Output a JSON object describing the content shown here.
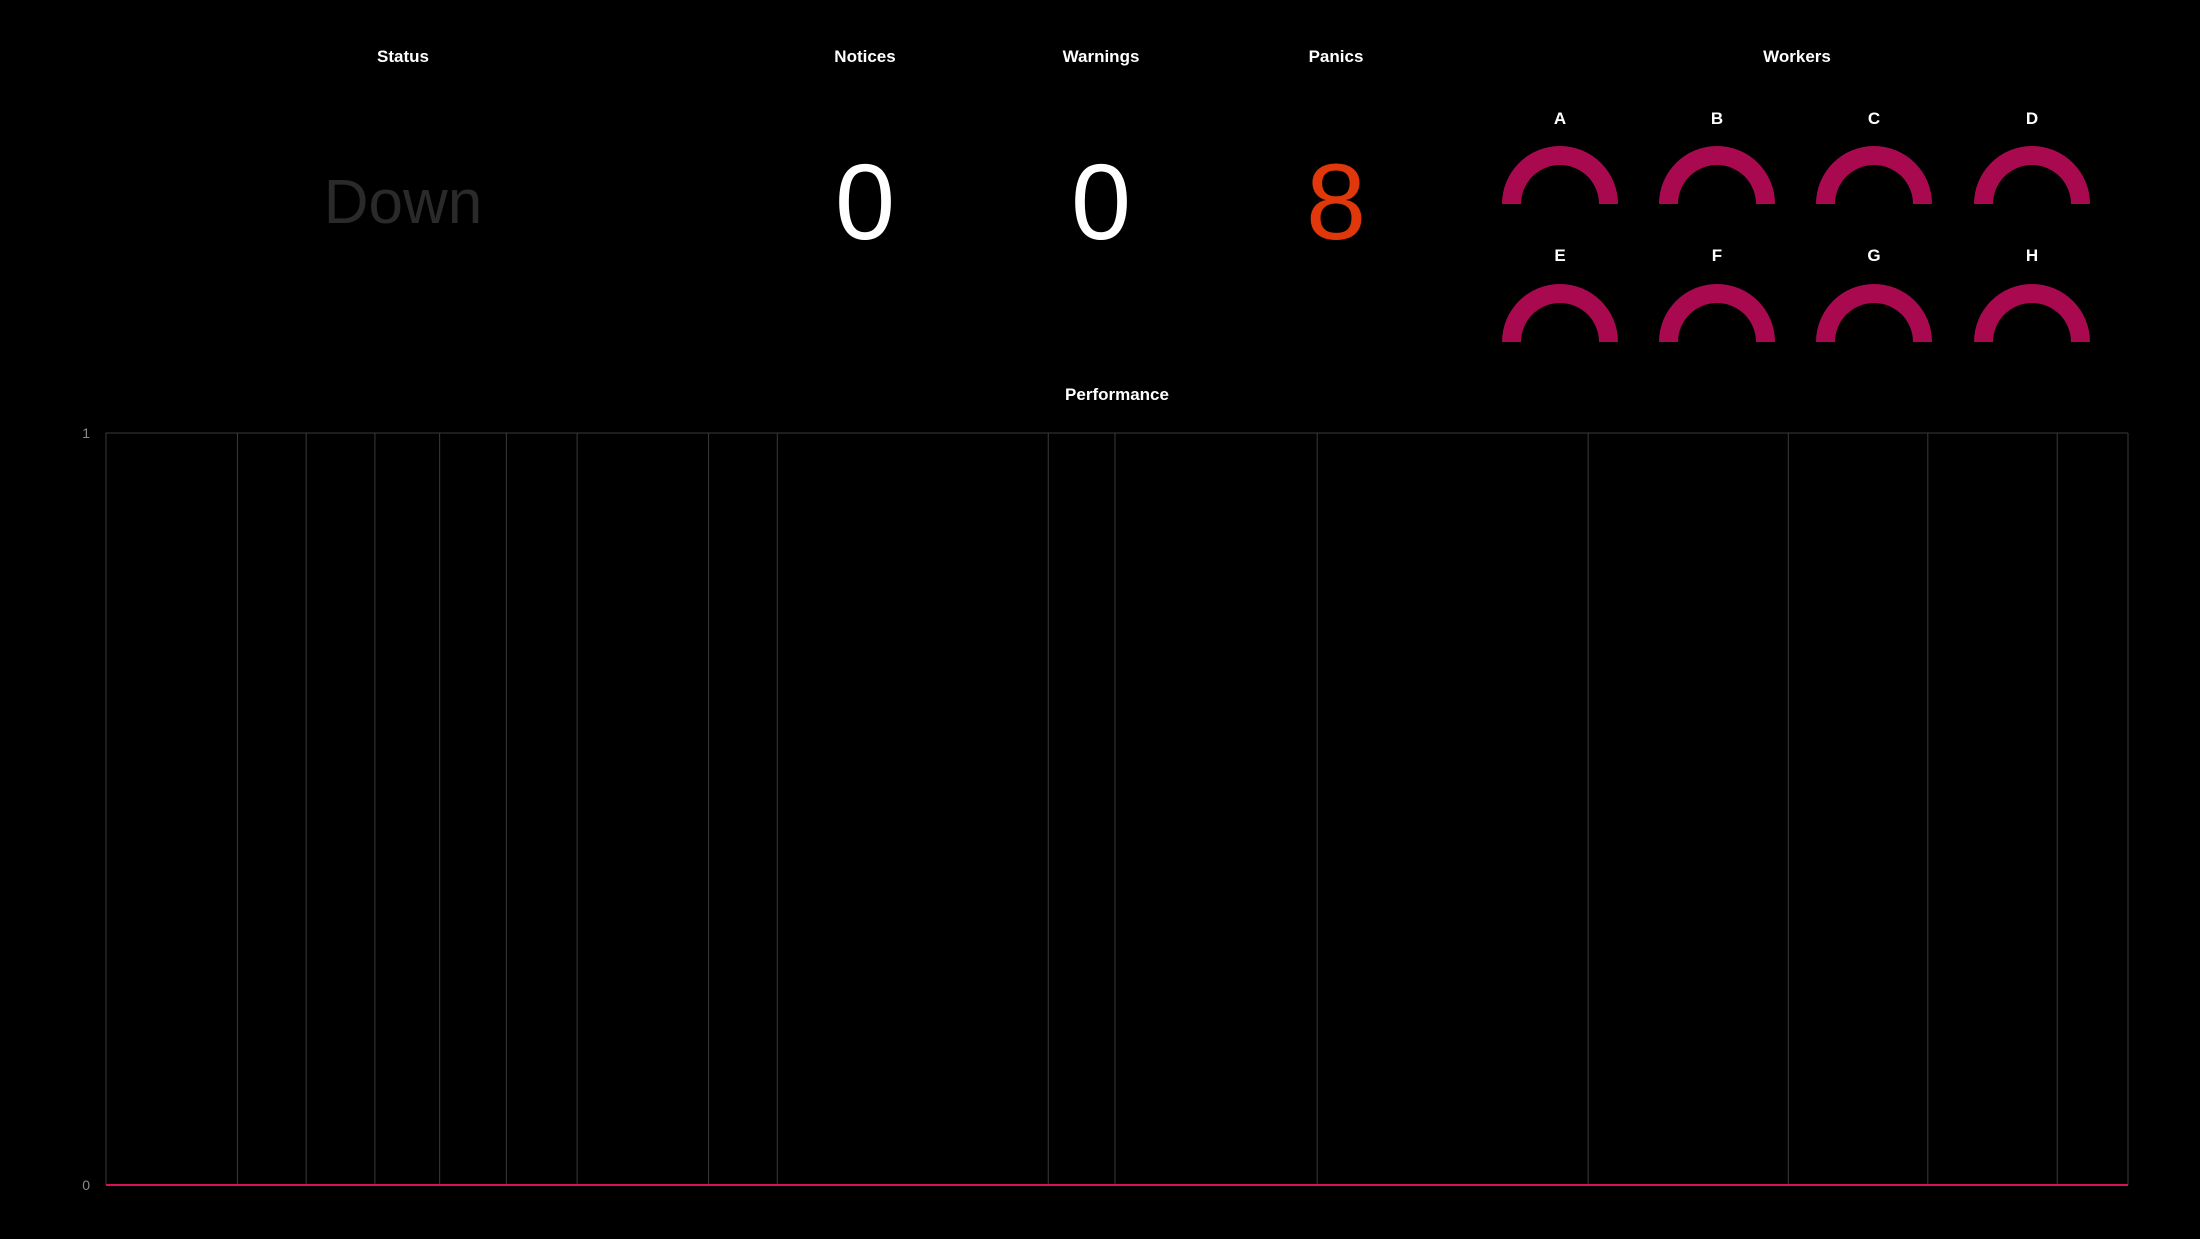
{
  "status": {
    "title": "Status",
    "value": "Down",
    "color": "#2a2a2a"
  },
  "stats": [
    {
      "id": "notices",
      "title": "Notices",
      "value": "0",
      "color": "#ffffff"
    },
    {
      "id": "warnings",
      "title": "Warnings",
      "value": "0",
      "color": "#ffffff"
    },
    {
      "id": "panics",
      "title": "Panics",
      "value": "8",
      "color": "#e0380a"
    }
  ],
  "workers": {
    "title": "Workers",
    "gauge_color": "#a8094f",
    "items": [
      {
        "label": "A"
      },
      {
        "label": "B"
      },
      {
        "label": "C"
      },
      {
        "label": "D"
      },
      {
        "label": "E"
      },
      {
        "label": "F"
      },
      {
        "label": "G"
      },
      {
        "label": "H"
      }
    ]
  },
  "performance": {
    "title": "Performance",
    "line_color": "#d6125a",
    "grid_color": "#3a3a3a"
  },
  "chart_data": {
    "type": "line",
    "title": "Performance",
    "xlabel": "",
    "ylabel": "",
    "ylim": [
      0,
      1
    ],
    "yticks": [
      "0",
      "1"
    ],
    "grid": true,
    "xlim": [
      0,
      1000
    ],
    "x_gridlines": [
      0,
      65,
      99,
      133,
      165,
      198,
      233,
      298,
      332,
      466,
      499,
      599,
      733,
      832,
      901,
      965,
      1000
    ],
    "series": [
      {
        "x": [
          0,
          1000
        ],
        "values": [
          0,
          0
        ]
      }
    ]
  }
}
